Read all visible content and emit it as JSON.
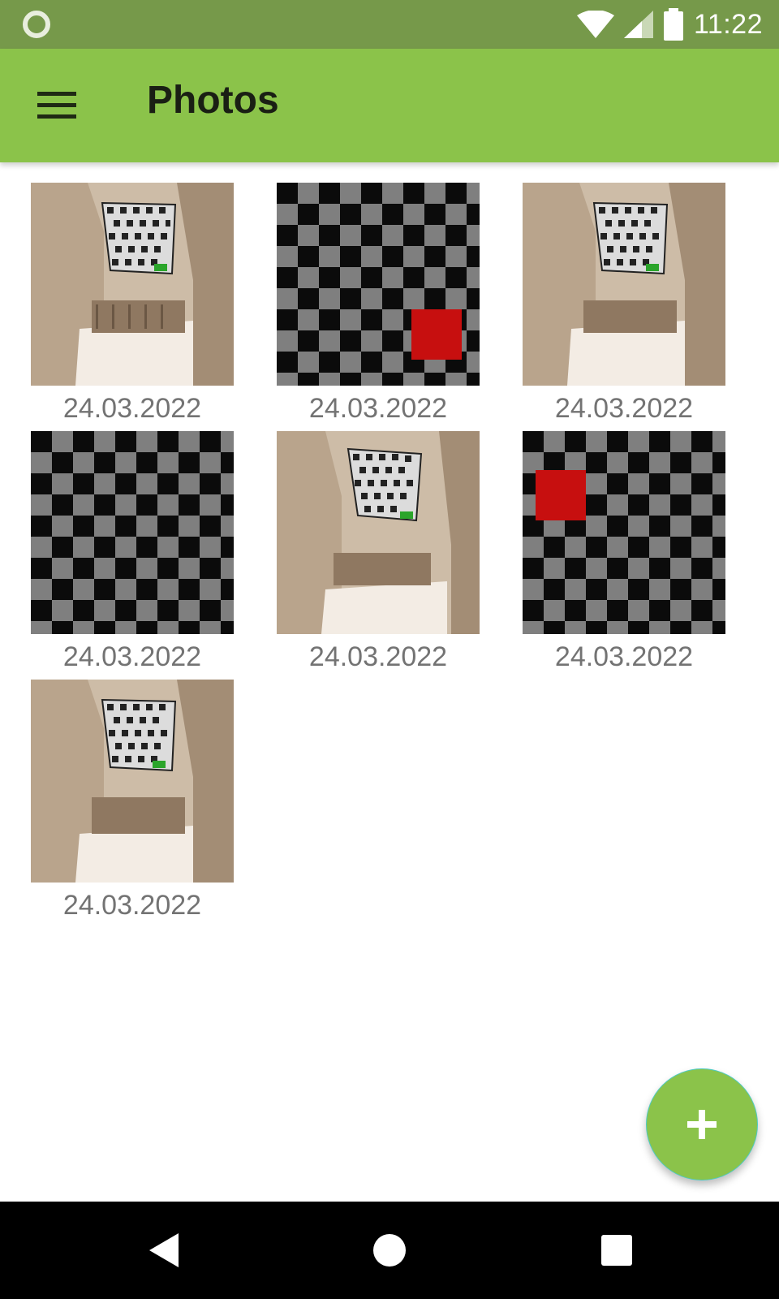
{
  "status_bar": {
    "time": "11:22",
    "icons": [
      "circle-notification-icon",
      "wifi-icon",
      "cell-signal-icon",
      "battery-icon"
    ]
  },
  "app_bar": {
    "title": "Photos",
    "menu_icon": "hamburger-menu-icon",
    "background": "#8bc34a"
  },
  "photos": [
    {
      "date": "24.03.2022",
      "kind": "room"
    },
    {
      "date": "24.03.2022",
      "kind": "checkerboard-red-square",
      "red_square": "bottom-right"
    },
    {
      "date": "24.03.2022",
      "kind": "room"
    },
    {
      "date": "24.03.2022",
      "kind": "checkerboard"
    },
    {
      "date": "24.03.2022",
      "kind": "room"
    },
    {
      "date": "24.03.2022",
      "kind": "checkerboard-red-square",
      "red_square": "top-left"
    },
    {
      "date": "24.03.2022",
      "kind": "room"
    }
  ],
  "fab": {
    "icon": "plus-icon",
    "color": "#8bc34a"
  },
  "nav_bar": {
    "icons": [
      "back-icon",
      "home-icon",
      "recents-icon"
    ]
  }
}
